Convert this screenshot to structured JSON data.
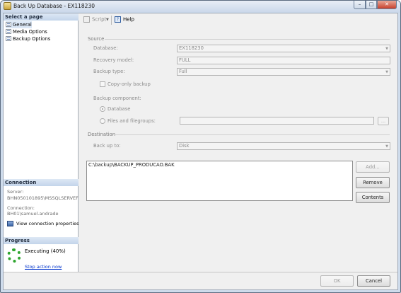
{
  "window": {
    "title": "Back Up Database - EX118230",
    "min_glyph": "–",
    "max_glyph": "□",
    "close_glyph": "✕"
  },
  "left": {
    "select_page_header": "Select a page",
    "pages": [
      {
        "label": "General"
      },
      {
        "label": "Media Options"
      },
      {
        "label": "Backup Options"
      }
    ],
    "connection_header": "Connection",
    "server_label": "Server:",
    "server_value": "BHN050101895\\MSSQLSERVEF",
    "connection_label": "Connection:",
    "connection_value": "BH01\\samuel.andrade",
    "view_connection": "View connection properties",
    "progress_header": "Progress",
    "progress_status": "Executing (40%)",
    "progress_percent": 40,
    "stop_action": "Stop action now"
  },
  "toolbar": {
    "script_label": "Script",
    "help_label": "Help"
  },
  "form": {
    "source_group": "Source",
    "database_label": "Database:",
    "database_value": "EX118230",
    "recovery_label": "Recovery model:",
    "recovery_value": "FULL",
    "backup_type_label": "Backup type:",
    "backup_type_value": "Full",
    "copy_only_label": "Copy-only backup",
    "component_label": "Backup component:",
    "component_database": "Database",
    "component_files": "Files and filegroups:",
    "files_value": "",
    "dots_label": "...",
    "destination_group": "Destination",
    "backup_to_label": "Back up to:",
    "backup_to_value": "Disk",
    "destinations": [
      "C:\\backup\\BACKUP_PRODUCAO.BAK"
    ],
    "add_button": "Add...",
    "remove_button": "Remove",
    "contents_button": "Contents"
  },
  "footer": {
    "ok": "OK",
    "cancel": "Cancel"
  }
}
